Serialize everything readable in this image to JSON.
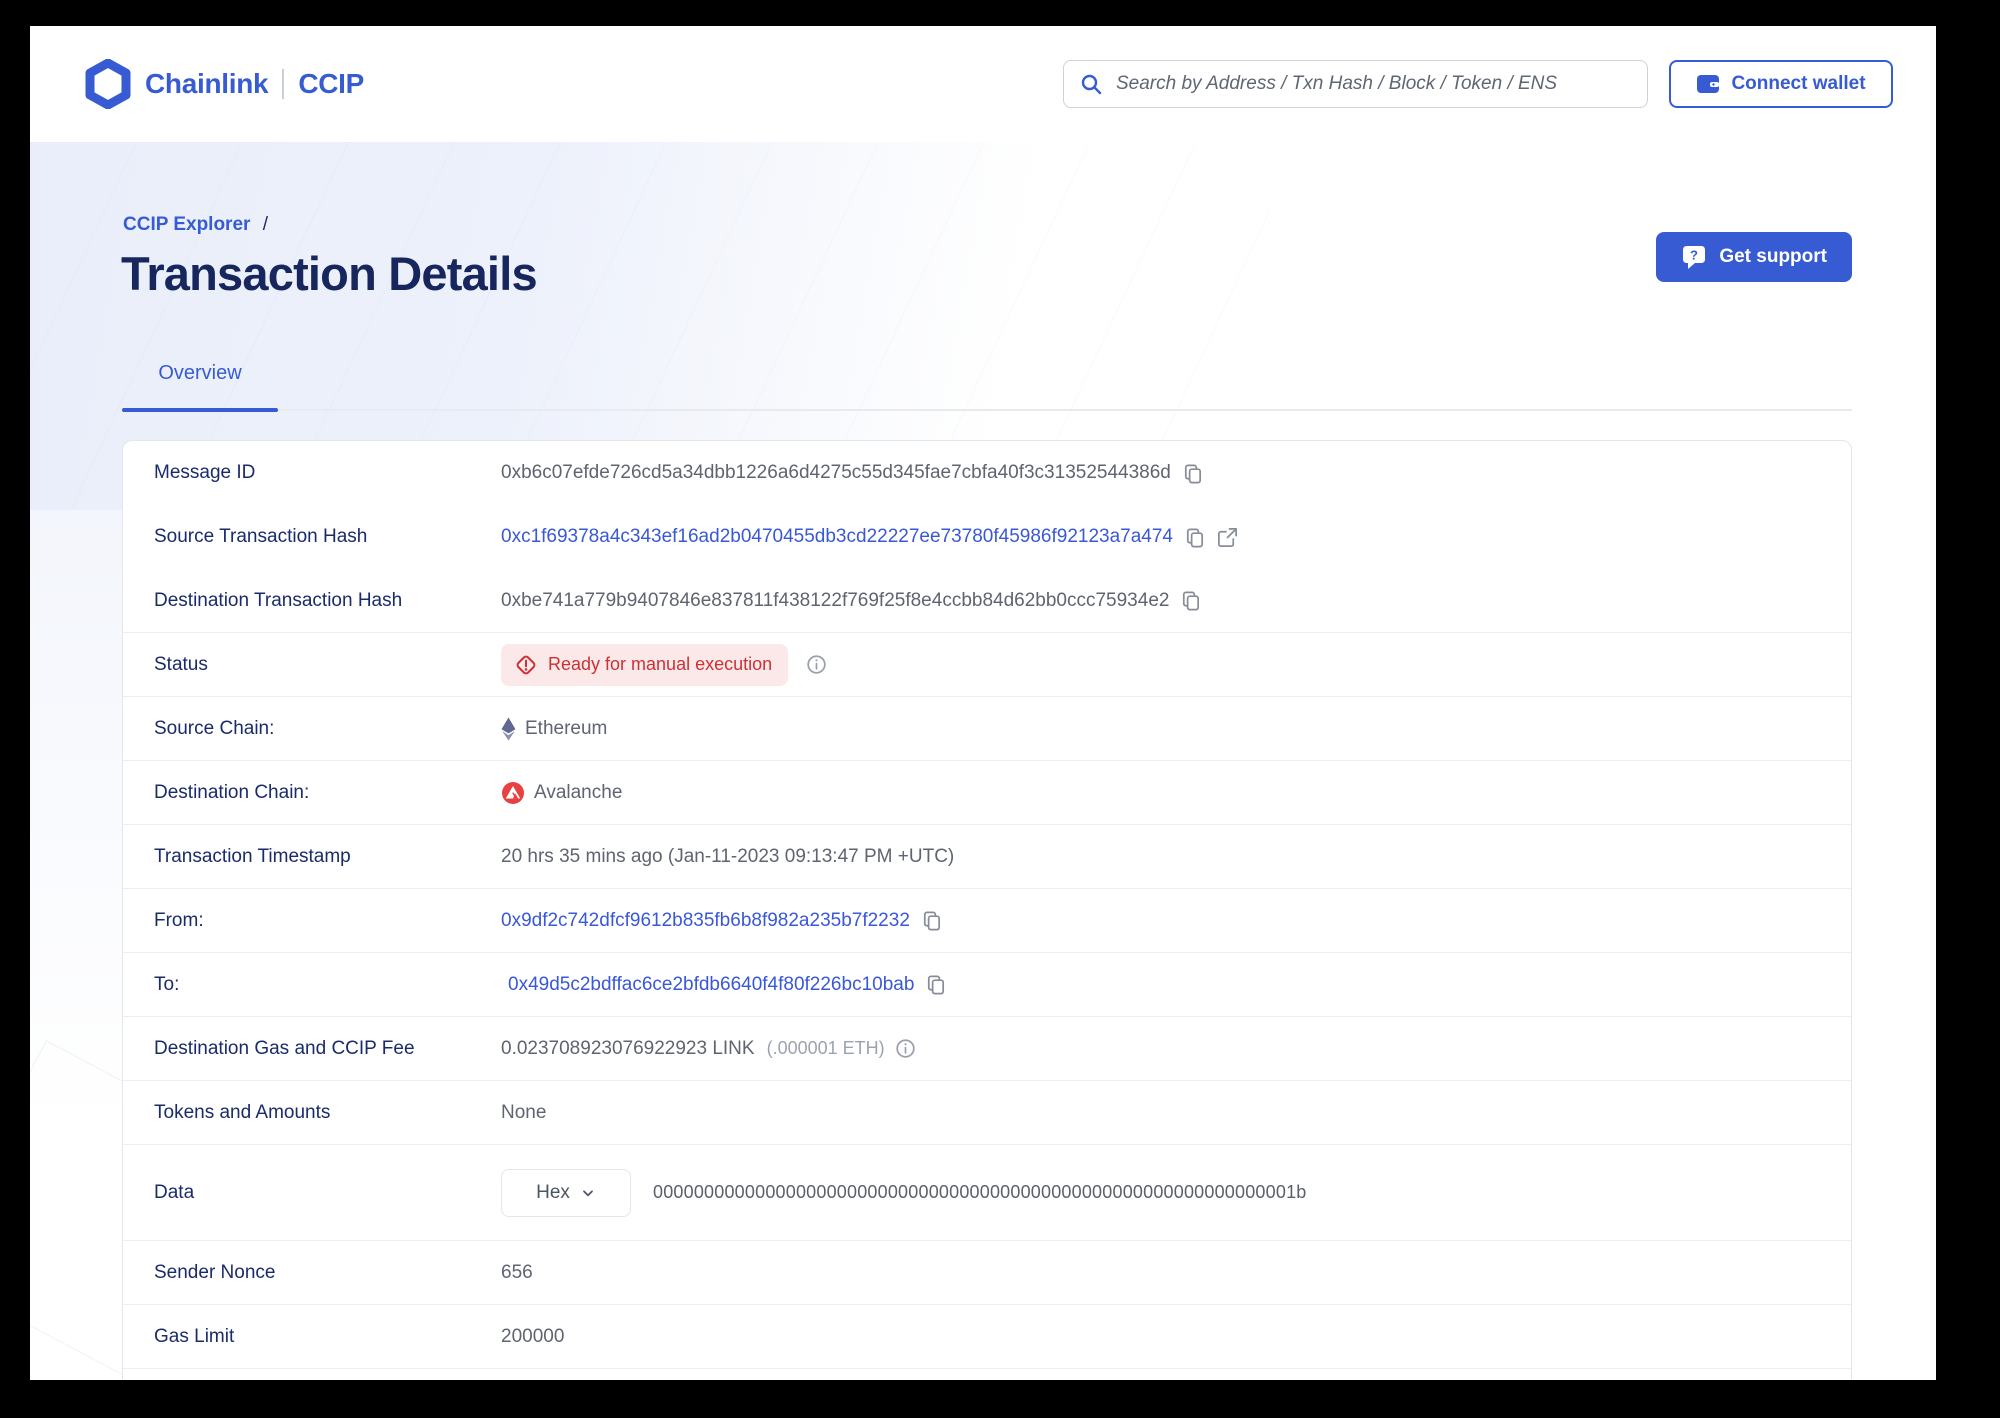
{
  "header": {
    "brand": {
      "name": "Chainlink",
      "product": "CCIP"
    },
    "search": {
      "placeholder": "Search by Address / Txn Hash / Block / Token / ENS"
    },
    "connect_wallet_label": "Connect wallet"
  },
  "breadcrumb": {
    "parent": "CCIP Explorer",
    "separator": "/"
  },
  "page_title": "Transaction Details",
  "support_button_label": "Get support",
  "tabs": {
    "overview": "Overview"
  },
  "colors": {
    "accent_blue": "#375BD2",
    "link_blue": "#3958D9",
    "navy_text": "#1A2B6B",
    "value_gray": "#5E6470",
    "status_red": "#CD3037",
    "status_badge_bg": "#FBE9E9",
    "avalanche_red": "#E84142",
    "ethereum_slate": "#62688F"
  },
  "details": {
    "rows": [
      {
        "label": "Message ID",
        "value": "0xb6c07efde726cd5a34dbb1226a6d4275c55d345fae7cbfa40f3c31352544386d"
      },
      {
        "label": "Source Transaction Hash",
        "value": "0xc1f69378a4c343ef16ad2b0470455db3cd22227ee73780f45986f92123a7a474"
      },
      {
        "label": "Destination Transaction Hash",
        "value": "0xbe741a779b9407846e837811f438122f769f25f8e4ccbb84d62bb0ccc75934e2"
      },
      {
        "label": "Status",
        "badge": "Ready for manual execution"
      },
      {
        "label": "Source Chain:",
        "value": "Ethereum"
      },
      {
        "label": "Destination Chain:",
        "value": "Avalanche"
      },
      {
        "label": "Transaction Timestamp",
        "value": "20 hrs 35 mins ago (Jan-11-2023 09:13:47 PM +UTC)"
      },
      {
        "label": "From:",
        "value": "0x9df2c742dfcf9612b835fb6b8f982a235b7f2232"
      },
      {
        "label": "To:",
        "value": "0x49d5c2bdffac6ce2bfdb6640f4f80f226bc10bab"
      },
      {
        "label": "Destination Gas and CCIP Fee",
        "value": "0.023708923076922923 LINK",
        "value_secondary": "(.000001 ETH)"
      },
      {
        "label": "Tokens and Amounts",
        "value": "None"
      },
      {
        "label": "Data",
        "dropdown_label": "Hex",
        "value": "000000000000000000000000000000000000000000000000000000000000001b"
      },
      {
        "label": "Sender Nonce",
        "value": "656"
      },
      {
        "label": "Gas Limit",
        "value": "200000"
      }
    ]
  }
}
